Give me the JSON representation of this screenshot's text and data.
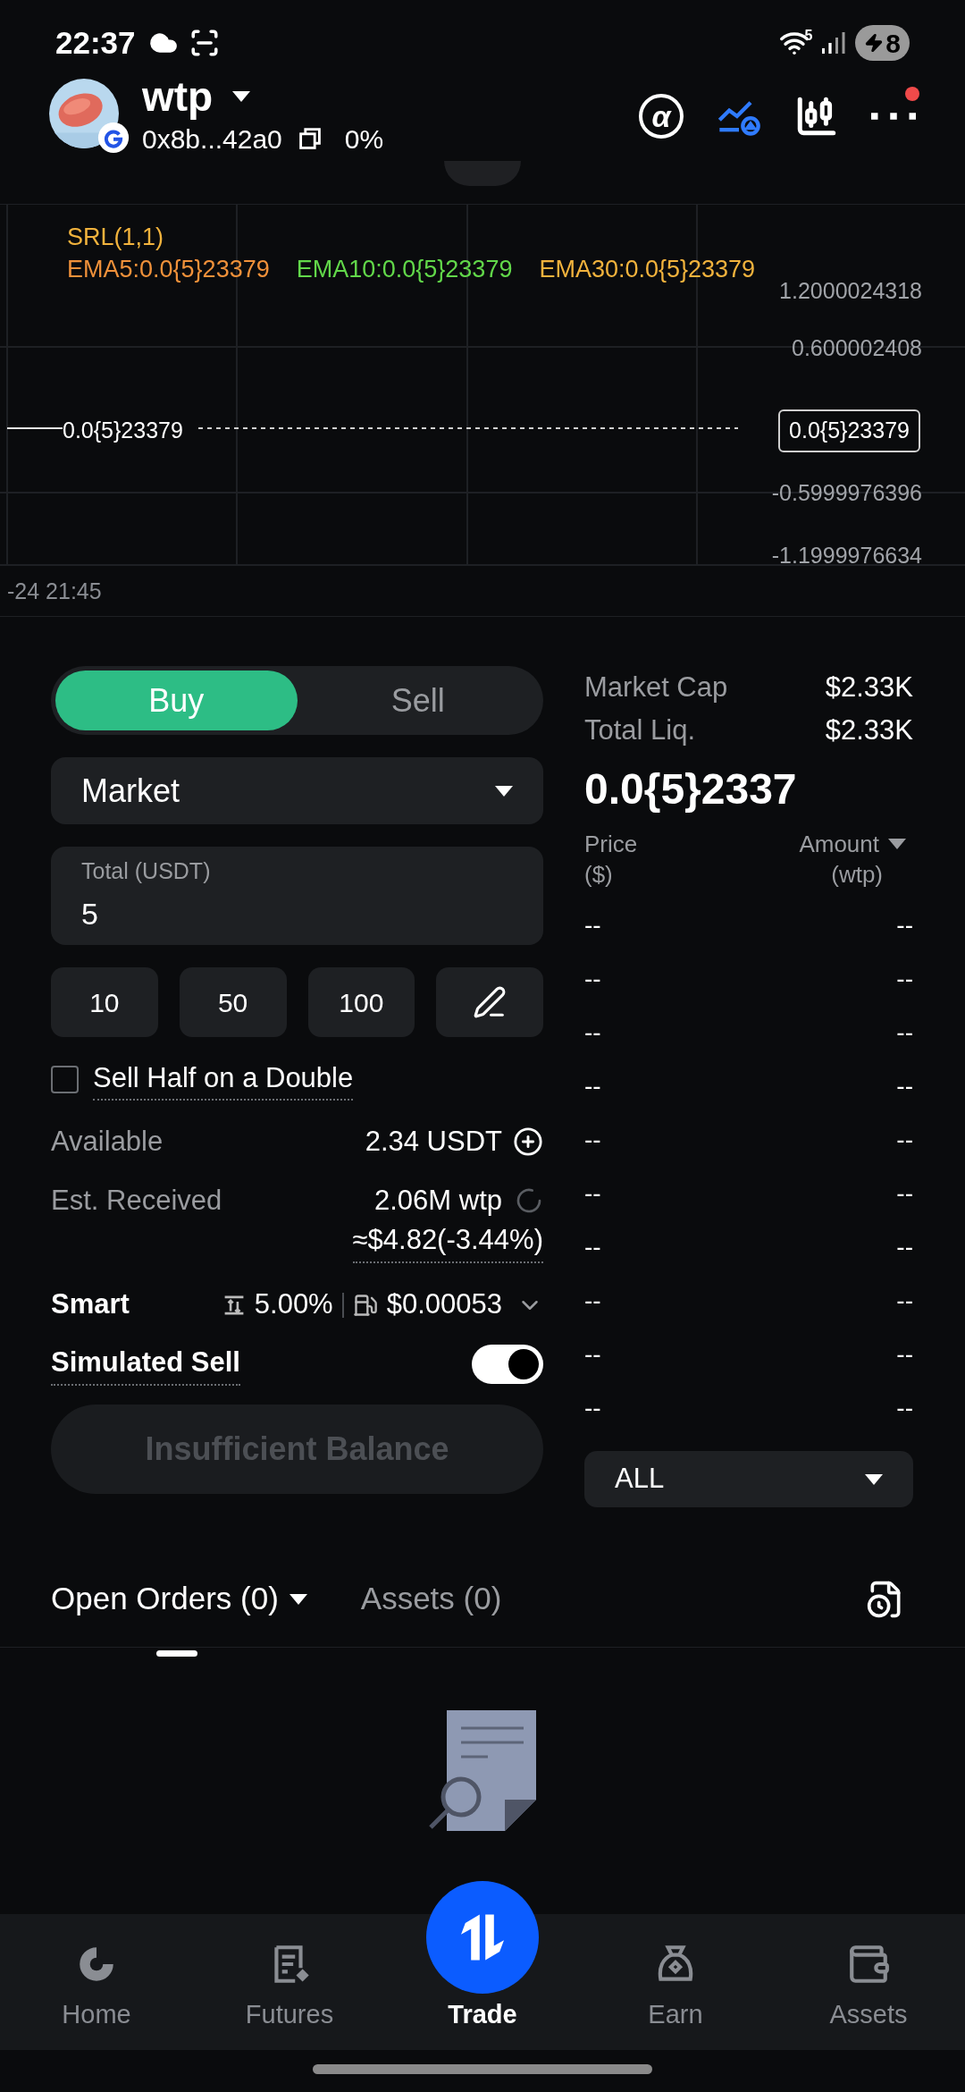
{
  "status_bar": {
    "time": "22:37",
    "wifi_label": "5",
    "battery": "8",
    "charging": true
  },
  "header": {
    "token": "wtp",
    "address": "0x8b...42a0",
    "change": "0%",
    "alpha_label": "α",
    "has_notification": true
  },
  "chart": {
    "legend": {
      "label": "SRL(1,1)",
      "color": "#f2b33d"
    },
    "indicators": [
      {
        "label": "EMA5:0.0{5}23379",
        "color": "#f0913a"
      },
      {
        "label": "EMA10:0.0{5}23379",
        "color": "#62d84a"
      },
      {
        "label": "EMA30:0.0{5}23379",
        "color": "#f2b33d"
      }
    ],
    "y_labels": [
      "1.2000024318",
      "0.600002408",
      "-0.5999976396",
      "-1.1999976634"
    ],
    "price_line_label": "0.0{5}23379",
    "price_tag": "0.0{5}23379",
    "time_label": "-24 21:45"
  },
  "trade": {
    "sides": [
      {
        "label": "Buy",
        "selected": true
      },
      {
        "label": "Sell",
        "selected": false
      }
    ],
    "order_type": "Market",
    "total": {
      "label": "Total (USDT)",
      "value": "5"
    },
    "quick_amounts": [
      "10",
      "50",
      "100"
    ],
    "sell_half": {
      "label": "Sell Half on a Double",
      "checked": false
    },
    "available": {
      "label": "Available",
      "value": "2.34 USDT"
    },
    "est_received": {
      "label": "Est. Received",
      "value": "2.06M wtp",
      "usd": "≈$4.82(-3.44%)"
    },
    "smart": {
      "label": "Smart",
      "slippage": "5.00%",
      "gas": "$0.00053"
    },
    "simulated_sell": {
      "label": "Simulated Sell",
      "on": true
    },
    "submit": {
      "label": "Insufficient Balance",
      "disabled": true
    }
  },
  "market": {
    "market_cap": {
      "label": "Market Cap",
      "value": "$2.33K"
    },
    "total_liq": {
      "label": "Total Liq.",
      "value": "$2.33K"
    },
    "price": "0.0{5}2337",
    "price_header": "Price",
    "price_unit": "($)",
    "amount_header": "Amount",
    "amount_unit": "(wtp)",
    "rows": [
      {
        "price": "--",
        "amount": "--"
      },
      {
        "price": "--",
        "amount": "--"
      },
      {
        "price": "--",
        "amount": "--"
      },
      {
        "price": "--",
        "amount": "--"
      },
      {
        "price": "--",
        "amount": "--"
      },
      {
        "price": "--",
        "amount": "--"
      },
      {
        "price": "--",
        "amount": "--"
      },
      {
        "price": "--",
        "amount": "--"
      },
      {
        "price": "--",
        "amount": "--"
      },
      {
        "price": "--",
        "amount": "--"
      }
    ],
    "filter": "ALL"
  },
  "orders": {
    "tabs": [
      {
        "label": "Open Orders (0)",
        "selected": true
      },
      {
        "label": "Assets (0)",
        "selected": false
      }
    ]
  },
  "nav": [
    {
      "label": "Home",
      "selected": false
    },
    {
      "label": "Futures",
      "selected": false
    },
    {
      "label": "Trade",
      "selected": true
    },
    {
      "label": "Earn",
      "selected": false
    },
    {
      "label": "Assets",
      "selected": false
    }
  ]
}
